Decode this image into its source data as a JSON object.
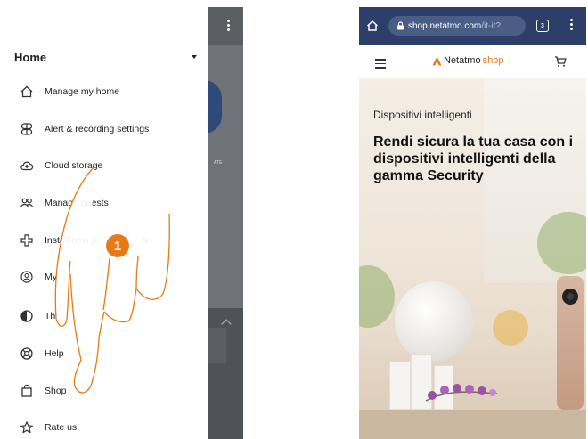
{
  "left_screen": {
    "drawer": {
      "home_label": "Home",
      "menu_items": [
        {
          "label": "Manage my home",
          "icon": "home-outline-icon"
        },
        {
          "label": "Alert & recording settings",
          "icon": "alert-settings-icon"
        },
        {
          "label": "Cloud storage",
          "icon": "cloud-upload-icon"
        },
        {
          "label": "Manage guests",
          "icon": "guests-icon"
        },
        {
          "label": "Install new p",
          "tail": "s",
          "icon": "install-plus-icon"
        },
        {
          "label": "My",
          "tail": "unt",
          "icon": "account-icon"
        },
        {
          "label": "Th",
          "icon": "theme-icon"
        },
        {
          "label": "Help",
          "tail": "ter",
          "icon": "help-lifebuoy-icon"
        },
        {
          "label": "Shop",
          "icon": "shop-bag-icon"
        },
        {
          "label": "Rate us!",
          "icon": "star-outline-icon"
        }
      ]
    },
    "background_fragment_text": "ATE",
    "gesture": {
      "step_number": "1",
      "badge_color": "#e67a17",
      "hand_color": "#e67a17"
    }
  },
  "right_screen": {
    "browser": {
      "url_main": "shop.netatmo.com",
      "url_dim": "/it-it?",
      "tabs_count": "3",
      "bar_color": "#2c3e69"
    },
    "site": {
      "logo_name": "Netatmo",
      "logo_shop": "shop",
      "accent_color": "#e67a17"
    },
    "hero": {
      "kicker": "Dispositivi intelligenti",
      "title": "Rendi sicura la tua casa con i dispositivi intelligenti della gamma Security"
    }
  }
}
